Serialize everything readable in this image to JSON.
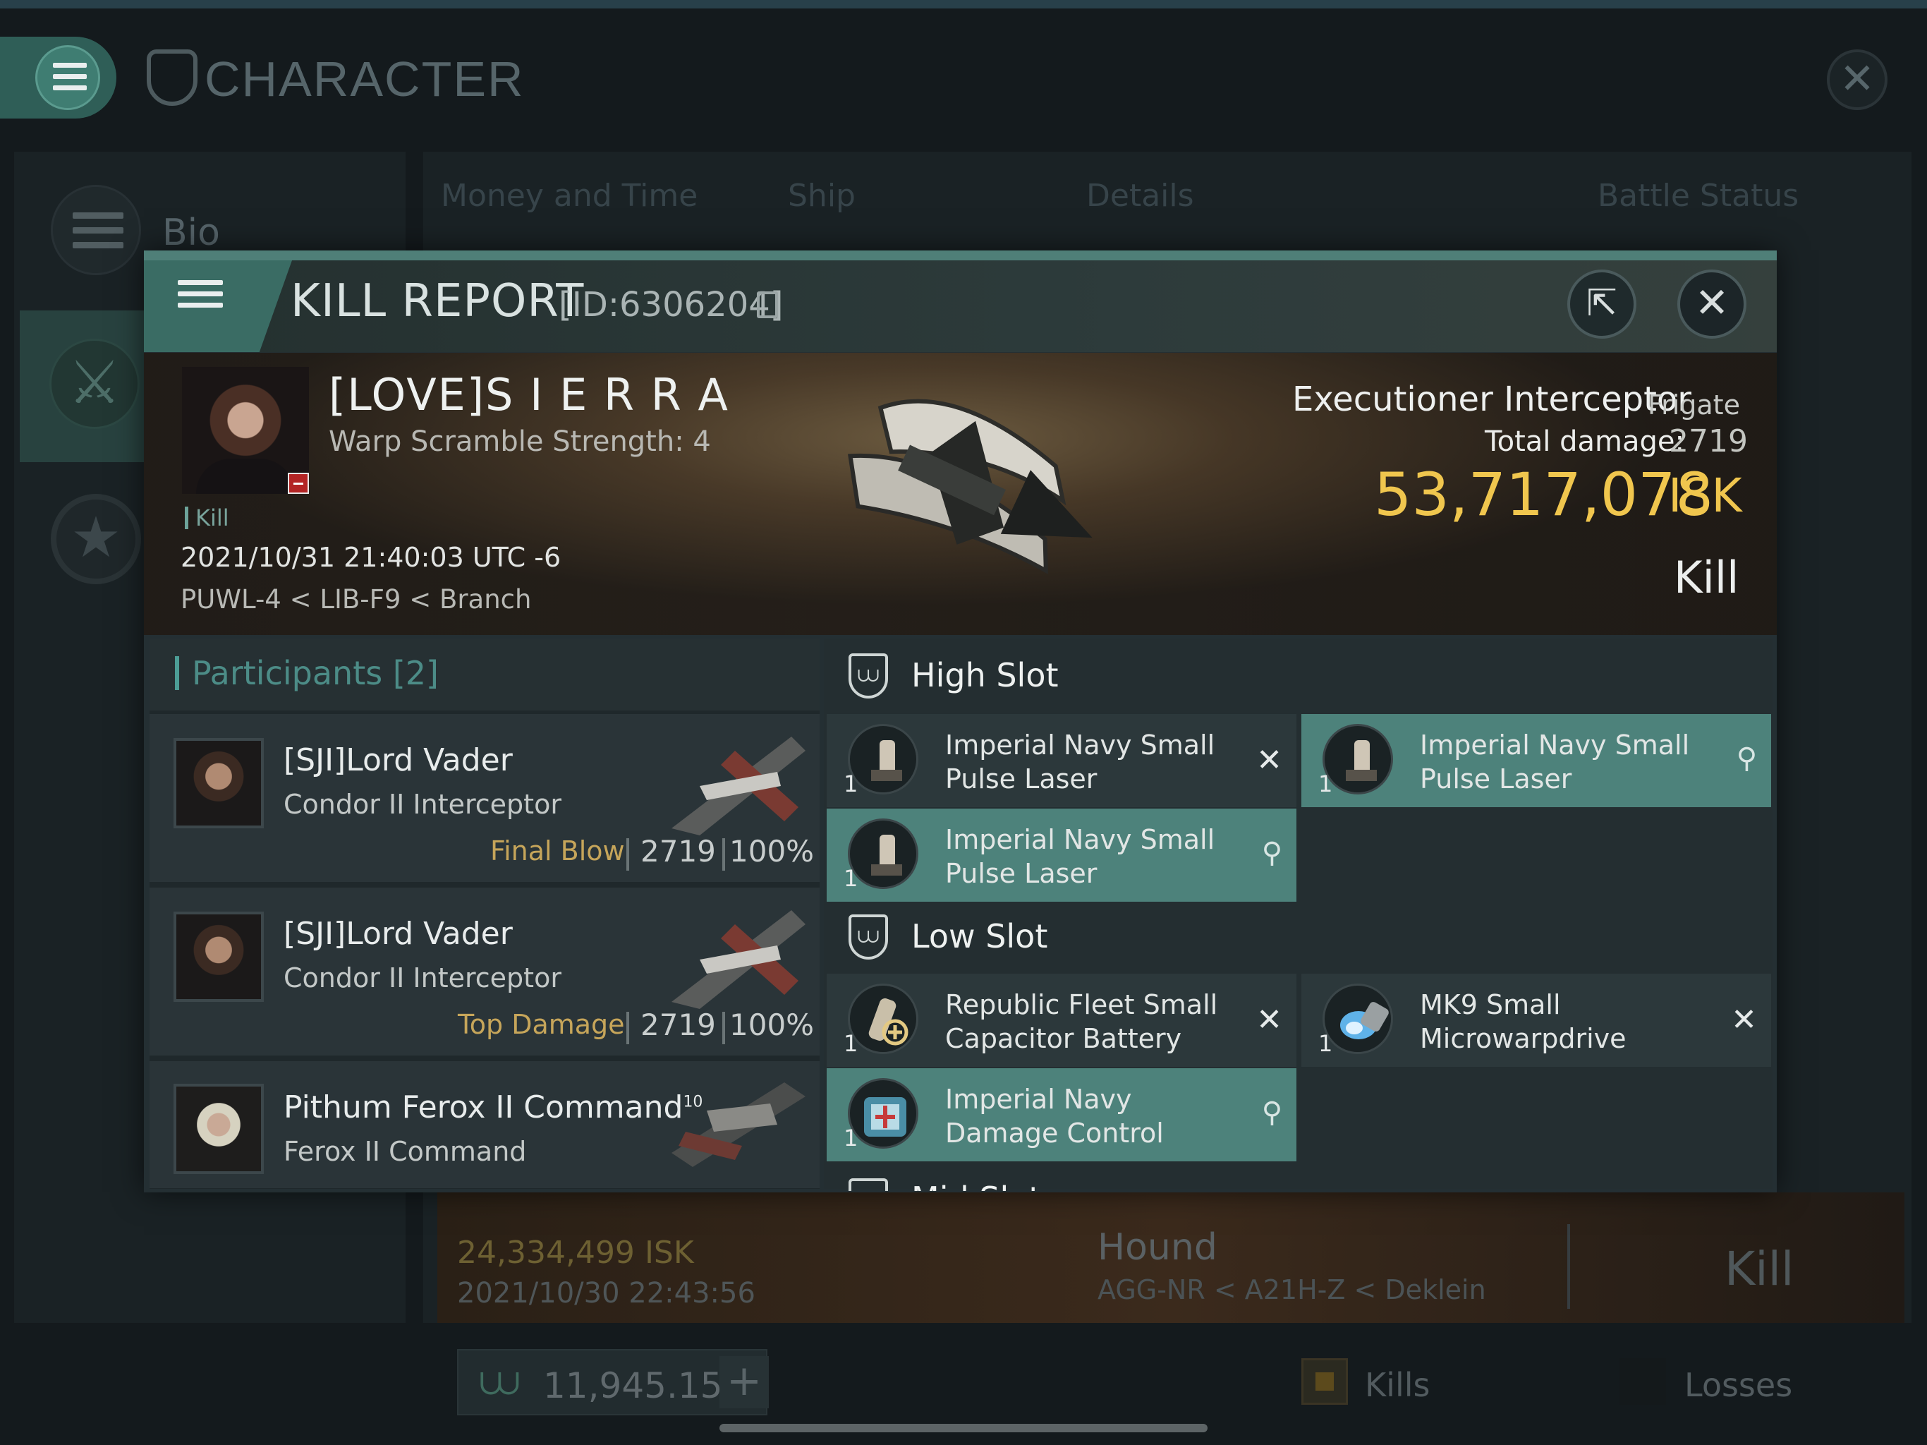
{
  "app": {
    "title": "CHARACTER",
    "nav": {
      "bio_label": "Bio"
    },
    "tabs": [
      "Money and Time",
      "Ship",
      "Details",
      "Battle Status"
    ]
  },
  "background_row": {
    "isk": "24,334,499",
    "isk_unit": "ISK",
    "date": "2021/10/30  22:43:56",
    "ship": "Hound",
    "location": "AGG-NR < A21H-Z < Deklein",
    "result": "Kill"
  },
  "bottom_bar": {
    "currency_value": "11,945.15",
    "plus": "+",
    "kills_label": "Kills",
    "losses_label": "Losses"
  },
  "modal": {
    "title": "KILL REPORT",
    "id": "[ID:6306204]",
    "victim": {
      "name": "[LOVE]S I E R R A",
      "warp": "Warp Scramble Strength: 4",
      "tag": "Kill",
      "datetime": "2021/10/31 21:40:03 UTC -6",
      "location": "PUWL-4 < LIB-F9 < Branch"
    },
    "ship": {
      "name": "Executioner Interceptor",
      "class": "Frigate",
      "damage_label": "Total damage:",
      "damage": "2719",
      "isk": "53,717,078",
      "isk_unit": "ISK",
      "result": "Kill"
    },
    "participants": {
      "title": "Participants",
      "count": "[2]",
      "rows": [
        {
          "name": "[SJI]Lord Vader",
          "ship": "Condor II Interceptor",
          "stat_label": "Final Blow",
          "damage": "2719",
          "percent": "100%"
        },
        {
          "name": "[SJI]Lord Vader",
          "ship": "Condor II Interceptor",
          "stat_label": "Top Damage",
          "damage": "2719",
          "percent": "100%"
        },
        {
          "name": "Pithum Ferox II Command",
          "superscript": "10",
          "ship": "Ferox II Command"
        }
      ]
    },
    "high_slot": {
      "title": "High Slot",
      "items": [
        {
          "qty": "1",
          "line1": "Imperial Navy Small",
          "line2": "Pulse Laser",
          "status": "destroyed",
          "mark": "✕"
        },
        {
          "qty": "1",
          "line1": "Imperial Navy Small",
          "line2": "Pulse Laser",
          "status": "dropped",
          "mark": "⚲"
        },
        {
          "qty": "1",
          "line1": "Imperial Navy Small",
          "line2": "Pulse Laser",
          "status": "dropped",
          "mark": "⚲"
        }
      ]
    },
    "low_slot": {
      "title": "Low Slot",
      "items": [
        {
          "qty": "1",
          "line1": "Republic Fleet Small",
          "line2": "Capacitor Battery",
          "status": "destroyed",
          "mark": "✕"
        },
        {
          "qty": "1",
          "line1": "MK9 Small",
          "line2": "Microwarpdrive",
          "status": "destroyed",
          "mark": "✕"
        },
        {
          "qty": "1",
          "line1": "Imperial Navy",
          "line2": "Damage Control",
          "status": "dropped",
          "mark": "⚲"
        }
      ]
    },
    "mid_slot": {
      "title": "Mid Slot"
    }
  },
  "colors": {
    "accent": "#4f7f78",
    "isk_gold": "#f0c64e",
    "dropped_item": "#4d827b",
    "destroyed_item": "#2c383b"
  }
}
